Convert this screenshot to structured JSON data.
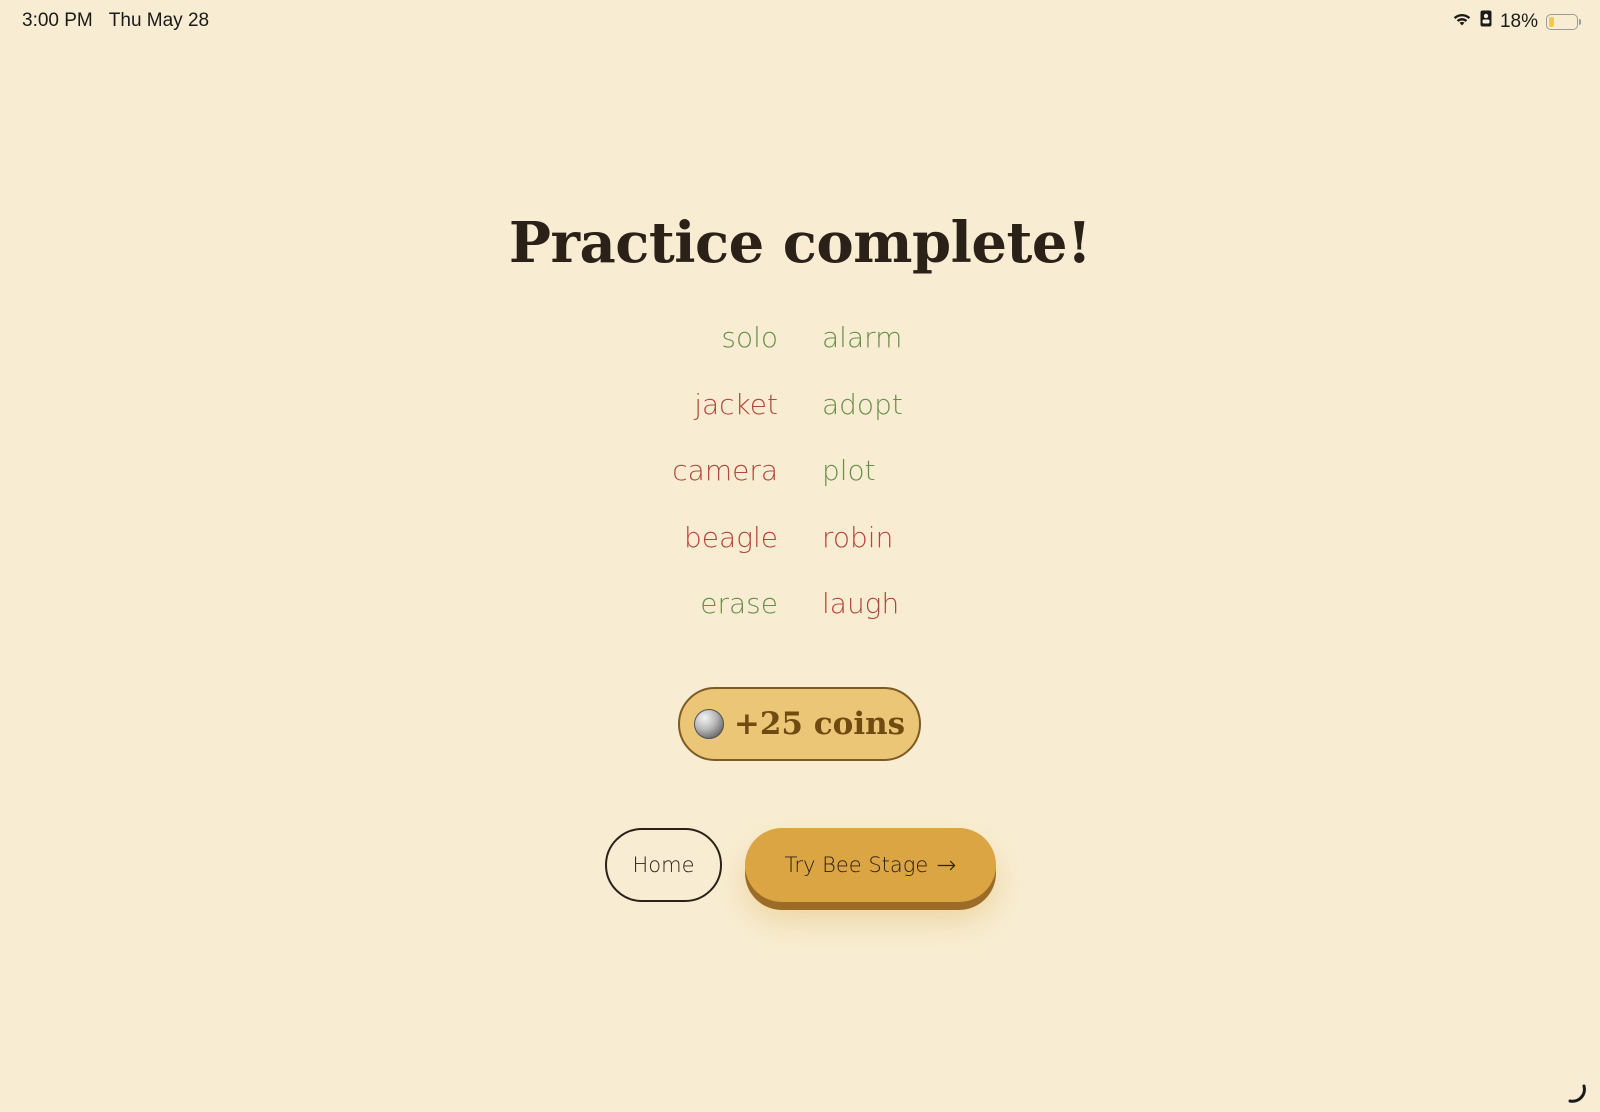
{
  "status_bar": {
    "time": "3:00 PM",
    "date": "Thu May 28",
    "battery_percent": "18%",
    "battery_level": 0.18,
    "icons": [
      "wifi-icon",
      "lock-icon",
      "battery-icon"
    ]
  },
  "title": "Practice complete!",
  "colors": {
    "correct": "#6a8f4a",
    "incorrect": "#b5463a",
    "background": "#f8edd2",
    "accent": "#dba544"
  },
  "words": [
    {
      "left": {
        "text": "solo",
        "status": "correct"
      },
      "right": {
        "text": "alarm",
        "status": "correct"
      }
    },
    {
      "left": {
        "text": "jacket",
        "status": "incorrect"
      },
      "right": {
        "text": "adopt",
        "status": "correct"
      }
    },
    {
      "left": {
        "text": "camera",
        "status": "incorrect"
      },
      "right": {
        "text": "plot",
        "status": "correct"
      }
    },
    {
      "left": {
        "text": "beagle",
        "status": "incorrect"
      },
      "right": {
        "text": "robin",
        "status": "incorrect"
      }
    },
    {
      "left": {
        "text": "erase",
        "status": "correct"
      },
      "right": {
        "text": "laugh",
        "status": "incorrect"
      }
    }
  ],
  "reward": {
    "icon": "coin-icon",
    "label": "+25 coins"
  },
  "buttons": {
    "home": "Home",
    "next": "Try Bee Stage",
    "next_arrow": "→"
  }
}
